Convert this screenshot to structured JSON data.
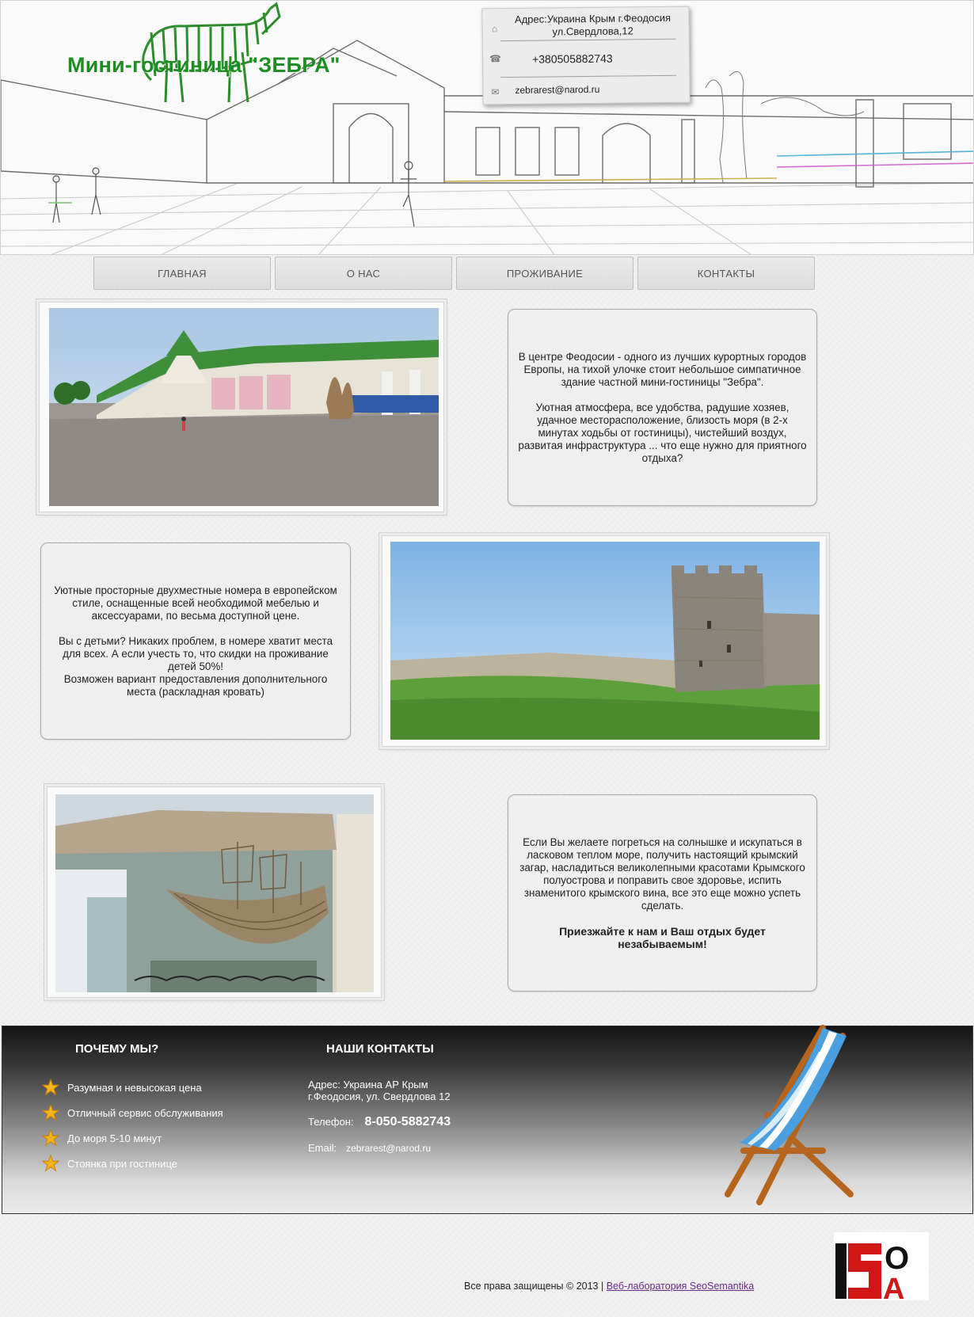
{
  "header": {
    "logo_text": "Мини-гостиница \"ЗЕБРА\"",
    "contact_card": {
      "address": "Адрес:Украина Крым г.Феодосия ул.Свердлова,12",
      "phone": "+380505882743",
      "email": "zebrarest@narod.ru",
      "icons": [
        "home-icon",
        "phone-icon",
        "mail-icon"
      ]
    }
  },
  "nav": {
    "items": [
      {
        "label": "ГЛАВНАЯ"
      },
      {
        "label": "О НАС"
      },
      {
        "label": "ПРОЖИВАНИЕ"
      },
      {
        "label": "КОНТАКТЫ"
      }
    ]
  },
  "blocks": {
    "intro": {
      "p1": "В центре Феодосии - одного из лучших курортных городов Европы, на тихой улочке стоит небольшое симпатичное здание частной мини-гостиницы \"Зебра\".",
      "p2": "Уютная атмосфера, все удобства, радушие хозяев, удачное месторасположение, близость моря (в 2-х минутах ходьбы от гостиницы), чистейший воздух, развитая инфраструктура ... что еще нужно для приятного отдыха?"
    },
    "rooms": {
      "p1": "Уютные просторные двухместные номера в европейском стиле, оснащенные всей необходимой мебелью и аксессуарами, по весьма доступной цене.",
      "p2": "Вы с детьми? Никаких проблем, в номере хватит места для всех. А если учесть то, что скидки на проживание детей 50%!",
      "p3": "Возможен вариант предоставления дополнительного места (раскладная кровать)"
    },
    "sea": {
      "p1": "Если Вы желаете погреться на солнышке и искупаться в ласковом теплом море, получить настоящий крымский загар, насладиться великолепными красотами Крымского полуострова и поправить свое здоровье, испить знаменитого крымского вина, все это еще можно успеть сделать.",
      "p2": "Приезжайте к нам и Ваш отдых будет незабываемым!"
    }
  },
  "footer": {
    "why_title": "ПОЧЕМУ МЫ?",
    "why_items": [
      {
        "label": "Разумная и невысокая цена"
      },
      {
        "label": "Отличный сервис обслуживания"
      },
      {
        "label": "До моря 5-10 минут"
      },
      {
        "label": "Стоянка при гостинице"
      }
    ],
    "contacts_title": "НАШИ КОНТАКТЫ",
    "address_line1": "Адрес: Украина АР Крым",
    "address_line2": "г.Феодосия, ул. Свердлова 12",
    "phone_label": "Телефон:",
    "phone_value": "8-050-5882743",
    "email_label": "Email:",
    "email_value": "zebrarest@narod.ru"
  },
  "bottom": {
    "copyright": "Все права защищены © 2013 |",
    "link": "Веб-лаборатория SeoSemantika"
  },
  "colors": {
    "brand_green": "#1f8e22",
    "link": "#6a2a8a"
  }
}
